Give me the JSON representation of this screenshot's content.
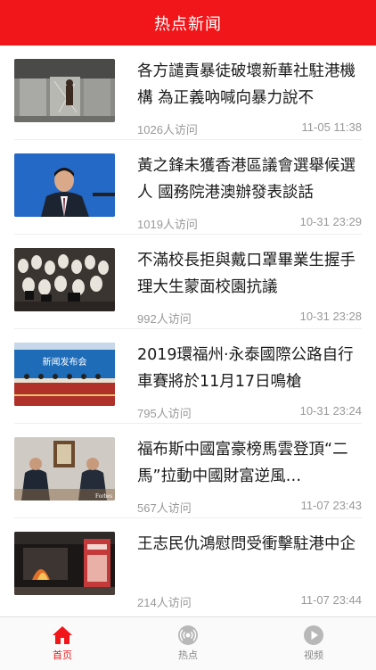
{
  "header": {
    "title": "热点新闻"
  },
  "news": [
    {
      "title": "各方譴責暴徒破壞新華社駐港機構 為正義吶喊向暴力說不",
      "visits": "1026人访问",
      "time": "11-05 11:38"
    },
    {
      "title": "黃之鋒未獲香港區議會選舉候選人 國務院港澳辦發表談話",
      "visits": "1019人访问",
      "time": "10-31 23:29"
    },
    {
      "title": "不滿校長拒與戴口罩畢業生握手 理大生蒙面校園抗議",
      "visits": "992人访问",
      "time": "10-31 23:28"
    },
    {
      "title": "2019環福州·永泰國際公路自行車賽將於11月17日鳴槍",
      "visits": "795人访问",
      "time": "10-31 23:24"
    },
    {
      "title": "福布斯中國富豪榜馬雲登頂“二馬”拉動中國財富逆風…",
      "visits": "567人访问",
      "time": "11-07 23:43"
    },
    {
      "title": "王志民仇鴻慰問受衝擊駐港中企",
      "visits": "214人访问",
      "time": "11-07 23:44"
    }
  ],
  "thumb_text": {
    "press_banner": "新闻发布会",
    "forbes": "Forbes"
  },
  "tabbar": {
    "tabs": [
      {
        "label": "首页",
        "icon": "home-icon",
        "active": true
      },
      {
        "label": "热点",
        "icon": "radio-icon",
        "active": false
      },
      {
        "label": "视频",
        "icon": "play-icon",
        "active": false
      }
    ]
  },
  "colors": {
    "accent": "#f0161a",
    "muted": "#999999"
  }
}
